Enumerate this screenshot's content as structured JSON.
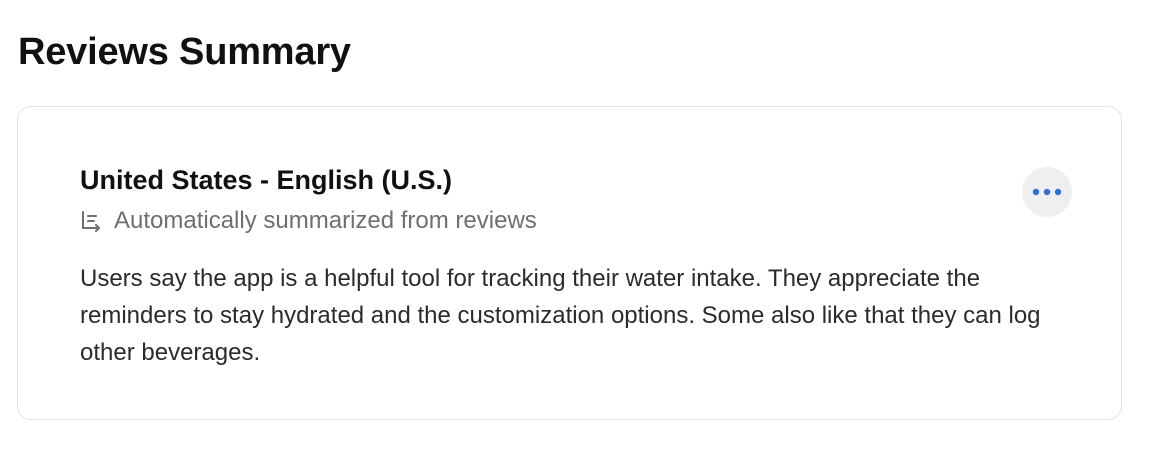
{
  "page": {
    "title": "Reviews Summary"
  },
  "summary_card": {
    "heading": "United States - English (U.S.)",
    "subtitle_icon": "summary-lines-icon",
    "subtitle": "Automatically summarized from reviews",
    "more_icon": "ellipsis-icon",
    "body": "Users say the app is a helpful tool for tracking their water intake. They appreciate the reminders to stay hydrated and the customization options. Some also like that they can log other beverages."
  },
  "colors": {
    "accent": "#2f6fcf",
    "secondary_text": "#6e6e73",
    "card_border": "#e3e3e6",
    "button_bg": "#efeff1"
  }
}
